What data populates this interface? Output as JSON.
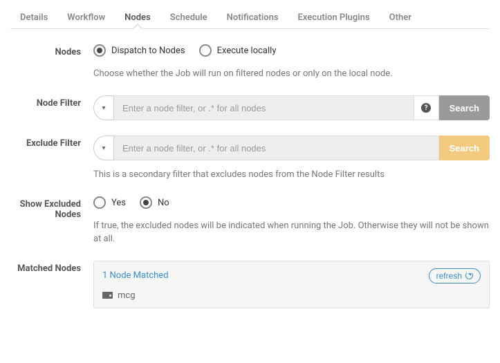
{
  "tabs": {
    "items": [
      "Details",
      "Workflow",
      "Nodes",
      "Schedule",
      "Notifications",
      "Execution Plugins",
      "Other"
    ],
    "active_index": 2
  },
  "nodes_mode": {
    "label": "Nodes",
    "options": {
      "dispatch": "Dispatch to Nodes",
      "local": "Execute locally"
    },
    "help": "Choose whether the Job will run on filtered nodes or only on the local node."
  },
  "node_filter": {
    "label": "Node Filter",
    "placeholder": "Enter a node filter, or .* for all nodes",
    "search": "Search"
  },
  "exclude_filter": {
    "label": "Exclude Filter",
    "placeholder": "Enter a node filter, or .* for all nodes",
    "search": "Search",
    "help": "This is a secondary filter that excludes nodes from the Node Filter results"
  },
  "show_excluded": {
    "label": "Show Excluded Nodes",
    "yes": "Yes",
    "no": "No",
    "help": "If true, the excluded nodes will be indicated when running the Job. Otherwise they will not be shown at all."
  },
  "matched": {
    "label": "Matched Nodes",
    "summary": "1 Node Matched",
    "refresh": "refresh",
    "nodes": [
      "mcg"
    ]
  }
}
